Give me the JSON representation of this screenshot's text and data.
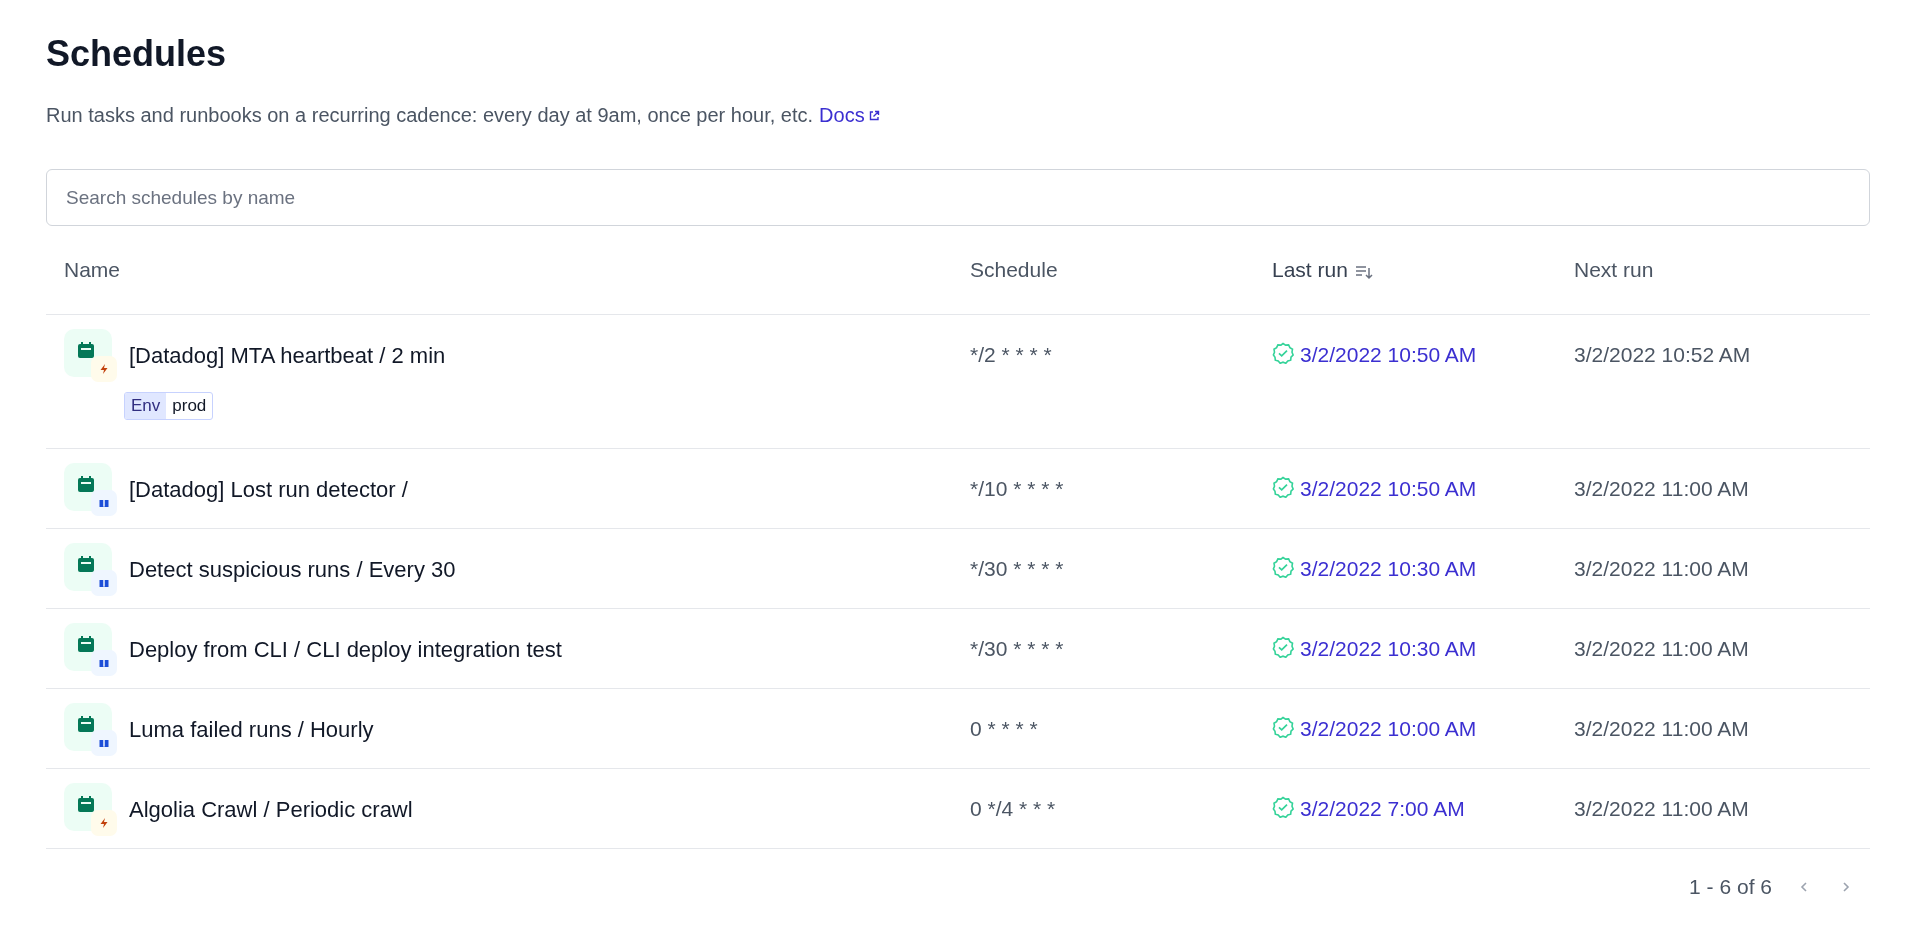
{
  "page": {
    "title": "Schedules",
    "description": "Run tasks and runbooks on a recurring cadence: every day at 9am, once per hour, etc.",
    "docs_link": "Docs"
  },
  "search": {
    "placeholder": "Search schedules by name"
  },
  "table": {
    "columns": [
      {
        "label": "Name",
        "sorted": false
      },
      {
        "label": "Schedule",
        "sorted": false
      },
      {
        "label": "Last run",
        "sorted": true
      },
      {
        "label": "Next run",
        "sorted": false
      }
    ],
    "rows": [
      {
        "kind": "task",
        "name": "[Datadog] MTA heartbeat / 2 min",
        "tags": [
          {
            "key": "Env",
            "value": "prod"
          }
        ],
        "schedule": "*/2 * * * *",
        "last_run_ok": true,
        "last_run": "3/2/2022 10:50 AM",
        "next_run": "3/2/2022 10:52 AM"
      },
      {
        "kind": "runbook",
        "name": "[Datadog] Lost run detector /",
        "tags": [],
        "schedule": "*/10 * * * *",
        "last_run_ok": true,
        "last_run": "3/2/2022 10:50 AM",
        "next_run": "3/2/2022 11:00 AM"
      },
      {
        "kind": "runbook",
        "name": "Detect suspicious runs / Every 30",
        "tags": [],
        "schedule": "*/30 * * * *",
        "last_run_ok": true,
        "last_run": "3/2/2022 10:30 AM",
        "next_run": "3/2/2022 11:00 AM"
      },
      {
        "kind": "runbook",
        "name": "Deploy from CLI / CLI deploy integration test",
        "tags": [],
        "schedule": "*/30 * * * *",
        "last_run_ok": true,
        "last_run": "3/2/2022 10:30 AM",
        "next_run": "3/2/2022 11:00 AM"
      },
      {
        "kind": "runbook",
        "name": "Luma failed runs / Hourly",
        "tags": [],
        "schedule": "0 * * * *",
        "last_run_ok": true,
        "last_run": "3/2/2022 10:00 AM",
        "next_run": "3/2/2022 11:00 AM"
      },
      {
        "kind": "task",
        "name": "Algolia Crawl / Periodic crawl",
        "tags": [],
        "schedule": "0 */4 * * *",
        "last_run_ok": true,
        "last_run": "3/2/2022 7:00 AM",
        "next_run": "3/2/2022 11:00 AM"
      }
    ]
  },
  "pagination": {
    "label": "1 - 6 of 6",
    "prev_disabled": true,
    "next_disabled": true
  }
}
